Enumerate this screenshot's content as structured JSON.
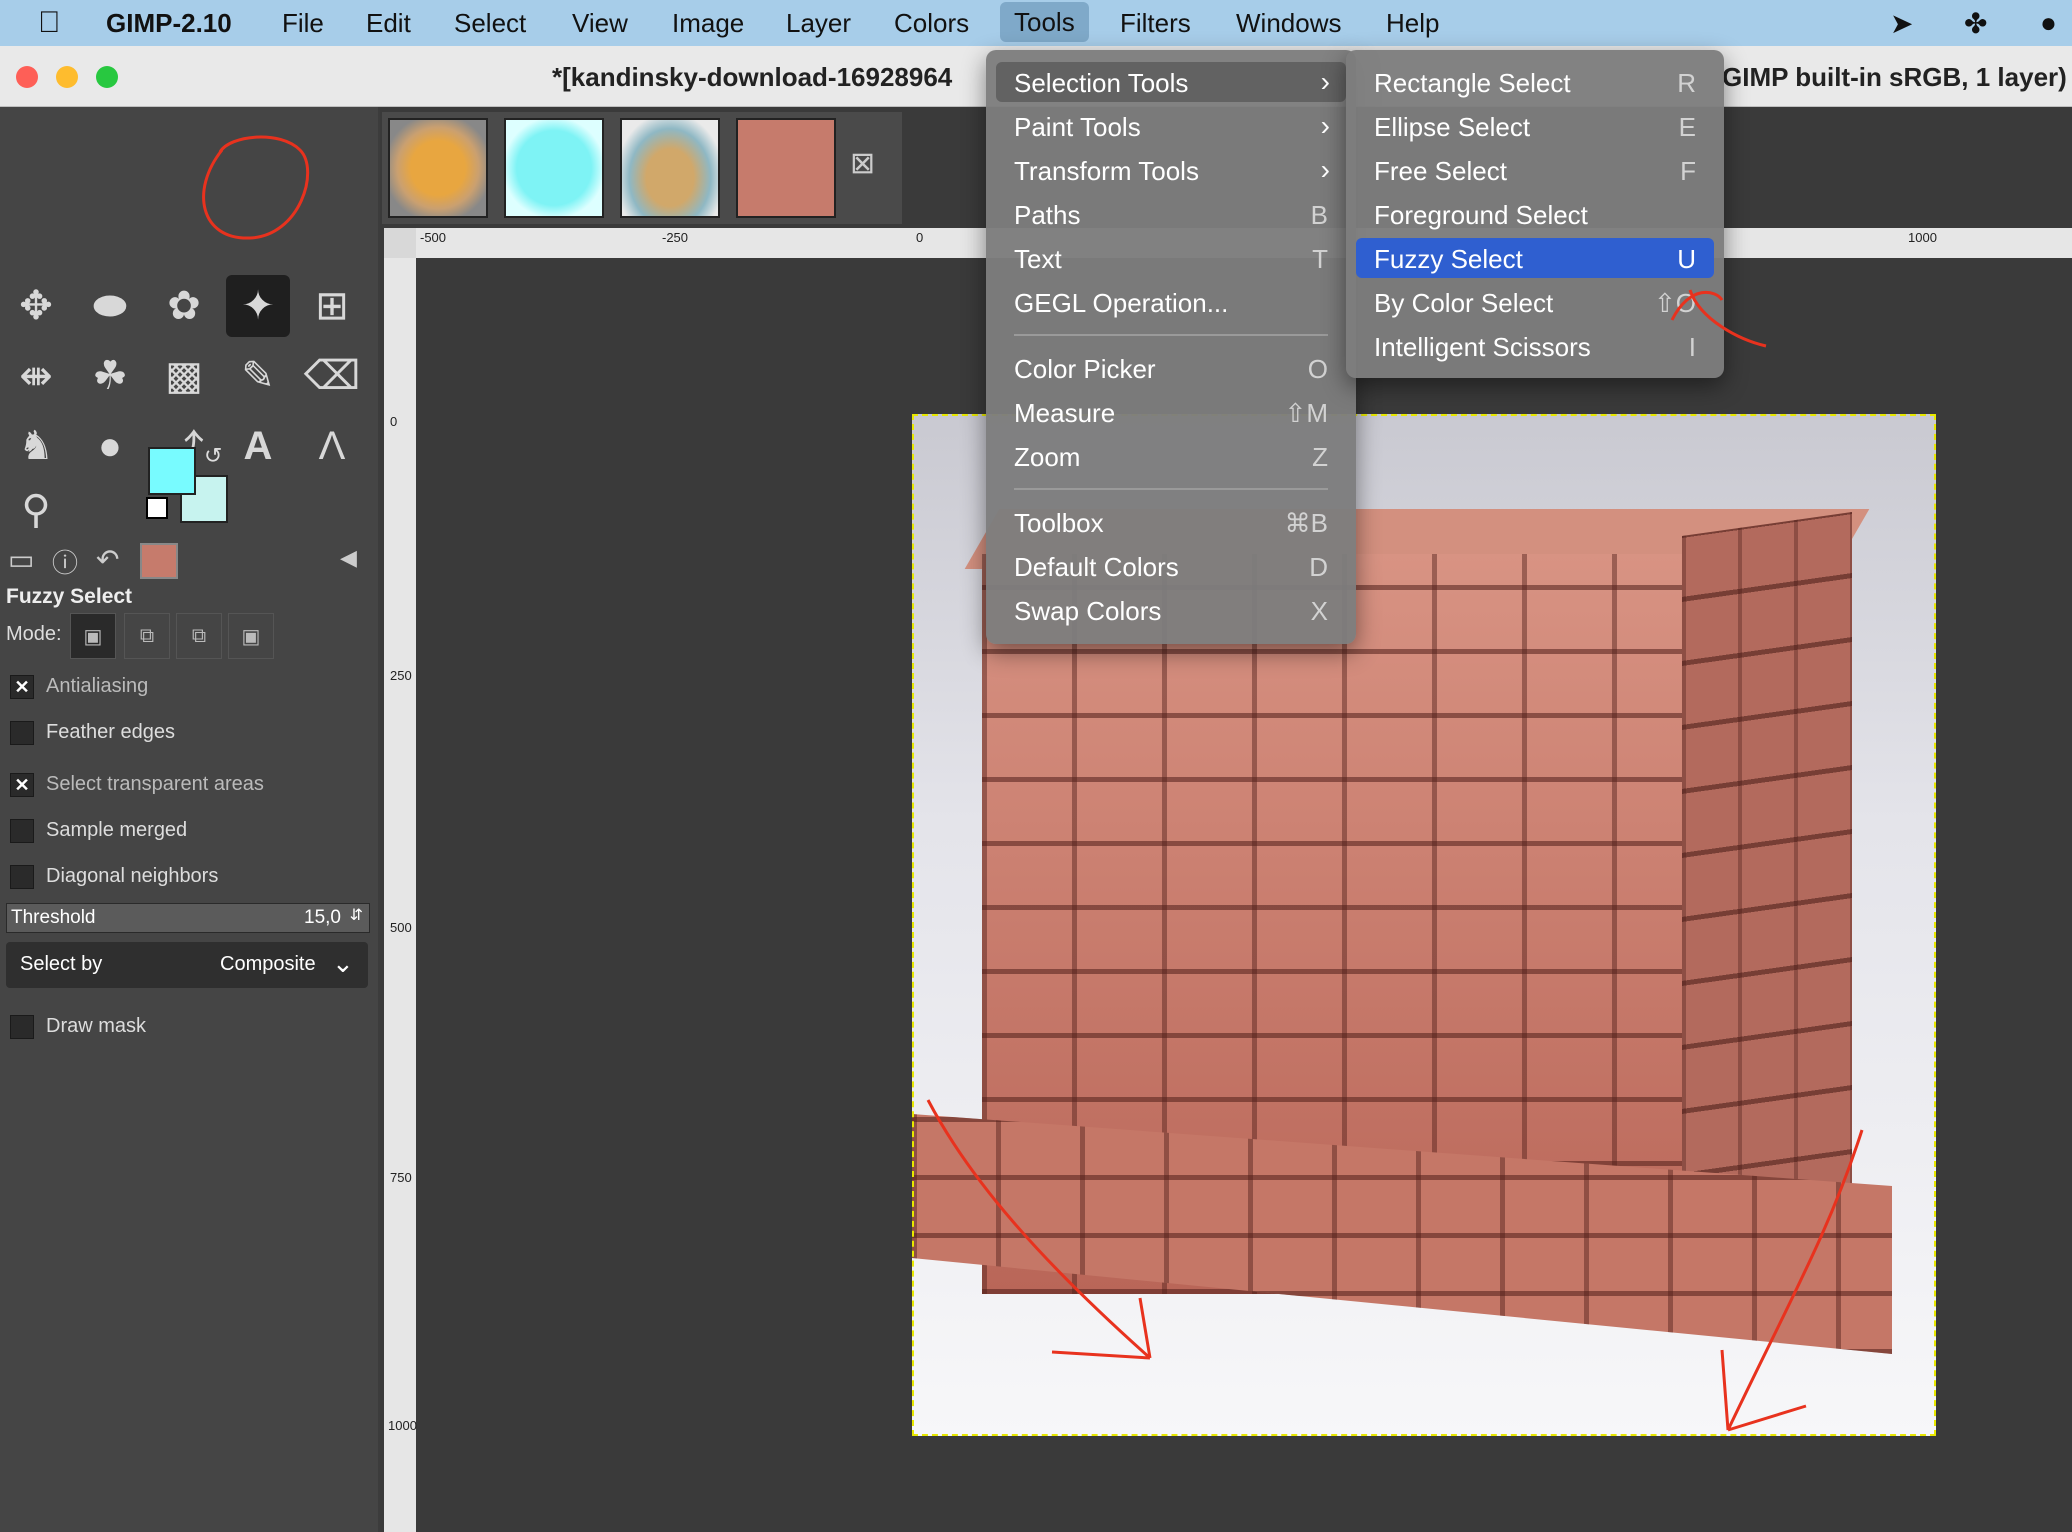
{
  "menubar": {
    "apple_icon": "apple-icon",
    "app_name": "GIMP-2.10",
    "items": [
      "File",
      "Edit",
      "Select",
      "View",
      "Image",
      "Layer",
      "Colors",
      "Tools",
      "Filters",
      "Windows",
      "Help"
    ],
    "active_item": "Tools",
    "status_icons": [
      "send-icon",
      "signature-icon",
      "user-icon"
    ]
  },
  "window": {
    "title_left": "*[kandinsky-download-16928964",
    "title_right": "GIMP built-in sRGB, 1 layer)"
  },
  "toolbox": {
    "tools": [
      "move-tool-icon",
      "ellipse-select-icon",
      "free-select-icon",
      "fuzzy-select-icon",
      "crop-icon",
      "flip-icon",
      "warp-icon",
      "gradient-icon",
      "paintbrush-icon",
      "eraser-icon",
      "clone-icon",
      "smudge-icon",
      "paths-icon",
      "text-icon",
      "measure-icon",
      "zoom-icon"
    ],
    "selected_tool": "fuzzy-select-icon",
    "foreground_color": "#78fbff",
    "background_color": "#c7f3ef"
  },
  "tool_options": {
    "title": "Fuzzy Select",
    "mode_label": "Mode:",
    "options": [
      {
        "label": "Antialiasing",
        "checked": true
      },
      {
        "label": "Feather edges",
        "checked": false
      },
      {
        "label": "Select transparent areas",
        "checked": true
      },
      {
        "label": "Sample merged",
        "checked": false
      },
      {
        "label": "Diagonal neighbors",
        "checked": false
      }
    ],
    "threshold_label": "Threshold",
    "threshold_value": "15,0",
    "select_by_label": "Select by",
    "select_by_value": "Composite",
    "draw_mask": {
      "label": "Draw mask",
      "checked": false
    }
  },
  "ruler": {
    "h_ticks": [
      "-500",
      "-250",
      "0",
      "1000"
    ],
    "v_ticks": [
      "0",
      "250",
      "500",
      "750",
      "1000"
    ]
  },
  "tools_menu": {
    "items": [
      {
        "label": "Selection Tools",
        "shortcut": "",
        "submenu": true
      },
      {
        "label": "Paint Tools",
        "shortcut": "",
        "submenu": true
      },
      {
        "label": "Transform Tools",
        "shortcut": "",
        "submenu": true
      },
      {
        "label": "Paths",
        "shortcut": "B",
        "submenu": false
      },
      {
        "label": "Text",
        "shortcut": "T",
        "submenu": false
      },
      {
        "label": "GEGL Operation...",
        "shortcut": "",
        "submenu": false
      },
      {
        "label": "Color Picker",
        "shortcut": "O",
        "submenu": false
      },
      {
        "label": "Measure",
        "shortcut": "⇧M",
        "submenu": false
      },
      {
        "label": "Zoom",
        "shortcut": "Z",
        "submenu": false
      },
      {
        "label": "Toolbox",
        "shortcut": "⌘B",
        "submenu": false
      },
      {
        "label": "Default Colors",
        "shortcut": "D",
        "submenu": false
      },
      {
        "label": "Swap Colors",
        "shortcut": "X",
        "submenu": false
      }
    ]
  },
  "selection_submenu": {
    "items": [
      {
        "label": "Rectangle Select",
        "shortcut": "R"
      },
      {
        "label": "Ellipse Select",
        "shortcut": "E"
      },
      {
        "label": "Free Select",
        "shortcut": "F"
      },
      {
        "label": "Foreground Select",
        "shortcut": ""
      },
      {
        "label": "Fuzzy Select",
        "shortcut": "U"
      },
      {
        "label": "By Color Select",
        "shortcut": "⇧O"
      },
      {
        "label": "Intelligent Scissors",
        "shortcut": "I"
      }
    ],
    "highlighted": "Fuzzy Select"
  },
  "colors": {
    "menubar_bg": "#a7cde9",
    "menu_bg": "#7d7d7d",
    "menu_highlight": "#2f5fd0",
    "annotation_red": "#e8321e",
    "selection_marching_ants": "#e8e800"
  }
}
